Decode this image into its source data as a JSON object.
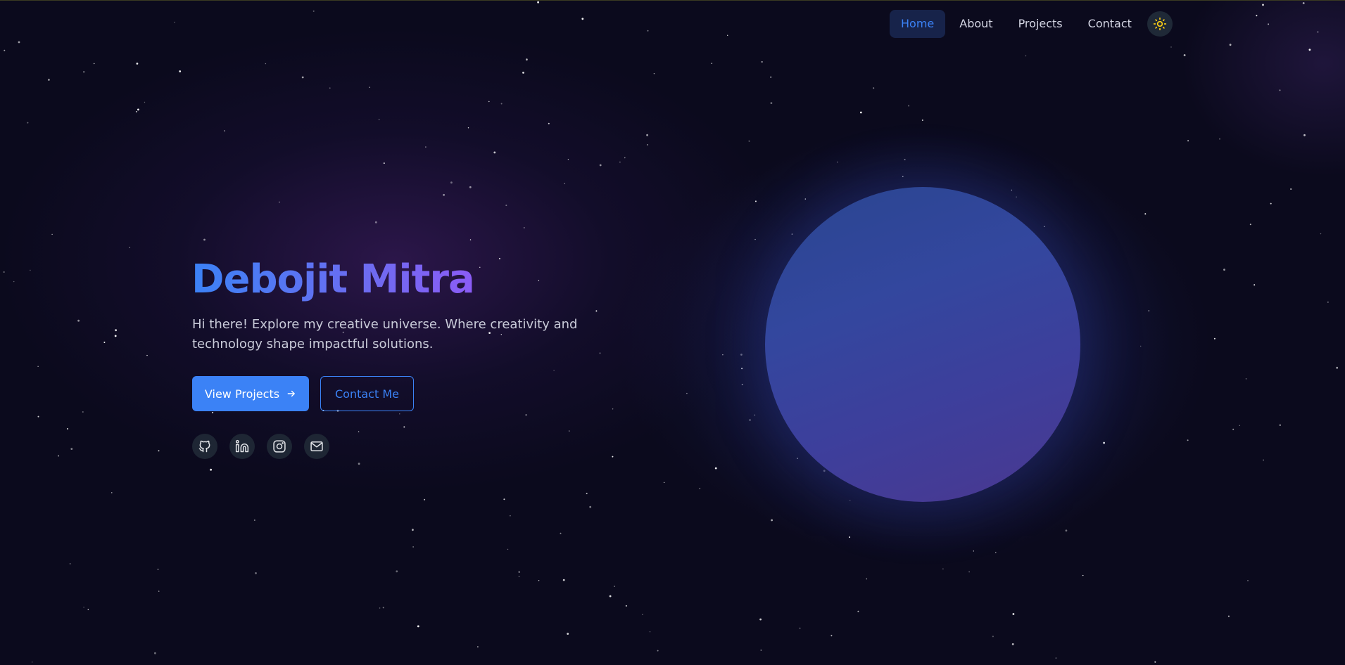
{
  "nav": {
    "items": [
      {
        "label": "Home",
        "active": true
      },
      {
        "label": "About",
        "active": false
      },
      {
        "label": "Projects",
        "active": false
      },
      {
        "label": "Contact",
        "active": false
      }
    ],
    "theme_toggle_icon": "sun-icon"
  },
  "hero": {
    "title": "Debojit Mitra",
    "subtitle": "Hi there! Explore my creative universe. Where creativity and technology shape impactful solutions.",
    "primary_button": {
      "label": "View Projects",
      "icon": "arrow-right-icon"
    },
    "secondary_button": {
      "label": "Contact Me"
    }
  },
  "socials": [
    {
      "name": "github",
      "icon": "github-icon"
    },
    {
      "name": "linkedin",
      "icon": "linkedin-icon"
    },
    {
      "name": "instagram",
      "icon": "instagram-icon"
    },
    {
      "name": "email",
      "icon": "mail-icon"
    }
  ],
  "colors": {
    "background": "#0b0a1d",
    "accent": "#3b82f6",
    "accent_secondary": "#8b5cf6",
    "sun": "#facc15"
  }
}
